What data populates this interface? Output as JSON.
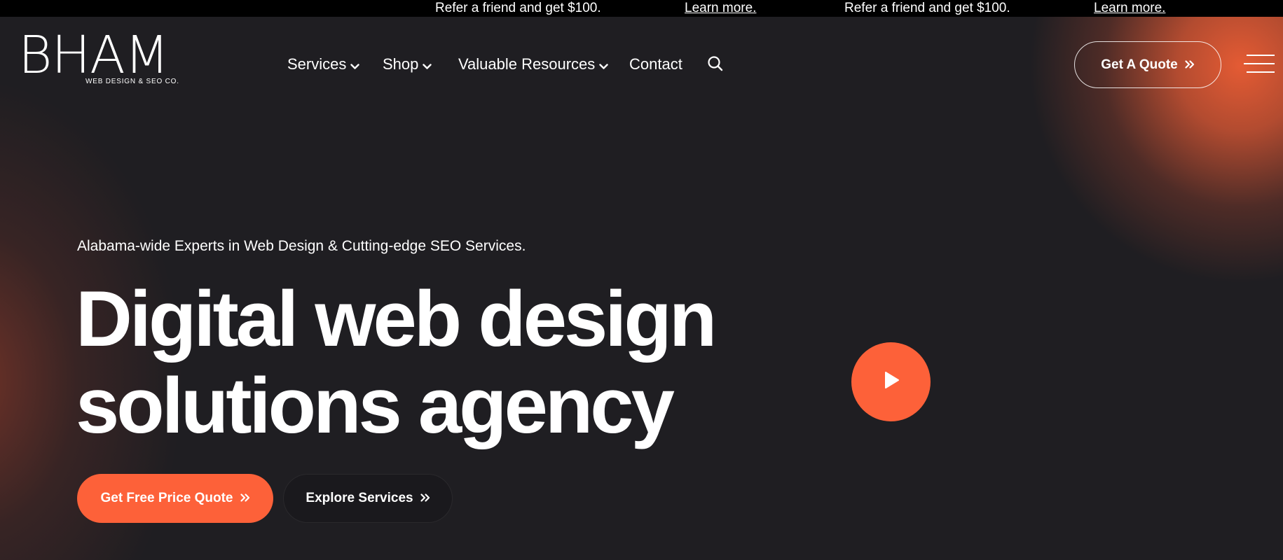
{
  "announcement": {
    "items": [
      {
        "text": "Refer a friend and get $100.",
        "link": "Learn more."
      },
      {
        "text": "Refer a friend and get $100.",
        "link": "Learn more."
      }
    ]
  },
  "logo": {
    "main": "BHAM",
    "sub": "WEB DESIGN & SEO CO."
  },
  "nav": {
    "items": [
      {
        "label": "Services",
        "icon": "chevron-down-icon"
      },
      {
        "label": "Shop",
        "icon": "chevron-down-icon"
      },
      {
        "label": "Valuable Resources",
        "icon": "chevron-down-icon"
      },
      {
        "label": "Contact"
      }
    ],
    "search_icon": "search-icon"
  },
  "header": {
    "quote_button": "Get A Quote",
    "menu_icon": "hamburger-menu-icon"
  },
  "hero": {
    "tagline": "Alabama-wide Experts in Web Design & Cutting-edge SEO Services.",
    "headline_line1": "Digital web design",
    "headline_line2": "solutions agency",
    "play_icon": "play-icon",
    "cta_primary": "Get Free Price Quote",
    "cta_secondary": "Explore Services"
  },
  "colors": {
    "accent": "#fd6139",
    "background": "#1f1e22",
    "topbar": "#000000",
    "text": "#ffffff"
  }
}
